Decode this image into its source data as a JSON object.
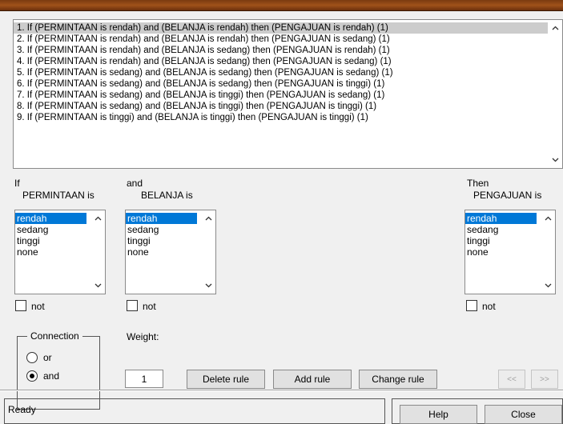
{
  "rules": {
    "items": [
      "1. If (PERMINTAAN is rendah) and (BELANJA is rendah) then (PENGAJUAN is rendah) (1)",
      "2. If (PERMINTAAN is rendah) and (BELANJA is rendah) then (PENGAJUAN is sedang) (1)",
      "3. If (PERMINTAAN is rendah) and (BELANJA is sedang) then (PENGAJUAN is rendah) (1)",
      "4. If (PERMINTAAN is rendah) and (BELANJA is sedang) then (PENGAJUAN is sedang) (1)",
      "5. If (PERMINTAAN is sedang) and (BELANJA is sedang) then (PENGAJUAN is sedang) (1)",
      "6. If (PERMINTAAN is sedang) and (BELANJA is sedang) then (PENGAJUAN is tinggi) (1)",
      "7. If (PERMINTAAN is sedang) and (BELANJA is tinggi) then (PENGAJUAN is sedang) (1)",
      "8. If (PERMINTAAN is sedang) and (BELANJA is tinggi) then (PENGAJUAN is tinggi) (1)",
      "9. If (PERMINTAAN is tinggi) and (BELANJA is tinggi) then (PENGAJUAN is tinggi) (1)"
    ],
    "selected_index": 0
  },
  "input1": {
    "prefix": "If",
    "variable_label": "PERMINTAAN is",
    "options": [
      "rendah",
      "sedang",
      "tinggi",
      "none"
    ],
    "selected": "rendah",
    "not_label": "not"
  },
  "input2": {
    "prefix": "and",
    "variable_label": "BELANJA is",
    "options": [
      "rendah",
      "sedang",
      "tinggi",
      "none"
    ],
    "selected": "rendah",
    "not_label": "not"
  },
  "output": {
    "prefix": "Then",
    "variable_label": "PENGAJUAN is",
    "options": [
      "rendah",
      "sedang",
      "tinggi",
      "none"
    ],
    "selected": "rendah",
    "not_label": "not"
  },
  "connection": {
    "title": "Connection",
    "or_label": "or",
    "and_label": "and",
    "selected": "and"
  },
  "weight": {
    "label": "Weight:",
    "value": "1"
  },
  "buttons": {
    "delete_rule": "Delete rule",
    "add_rule": "Add rule",
    "change_rule": "Change rule",
    "prev": "<<",
    "next": ">>",
    "help": "Help",
    "close": "Close"
  },
  "status": {
    "text": "Ready"
  },
  "colors": {
    "selection_blue": "#0078d7",
    "rule_highlight": "#cccccc",
    "window_bg": "#f0f0f0",
    "title_brown": "#a0521a"
  }
}
